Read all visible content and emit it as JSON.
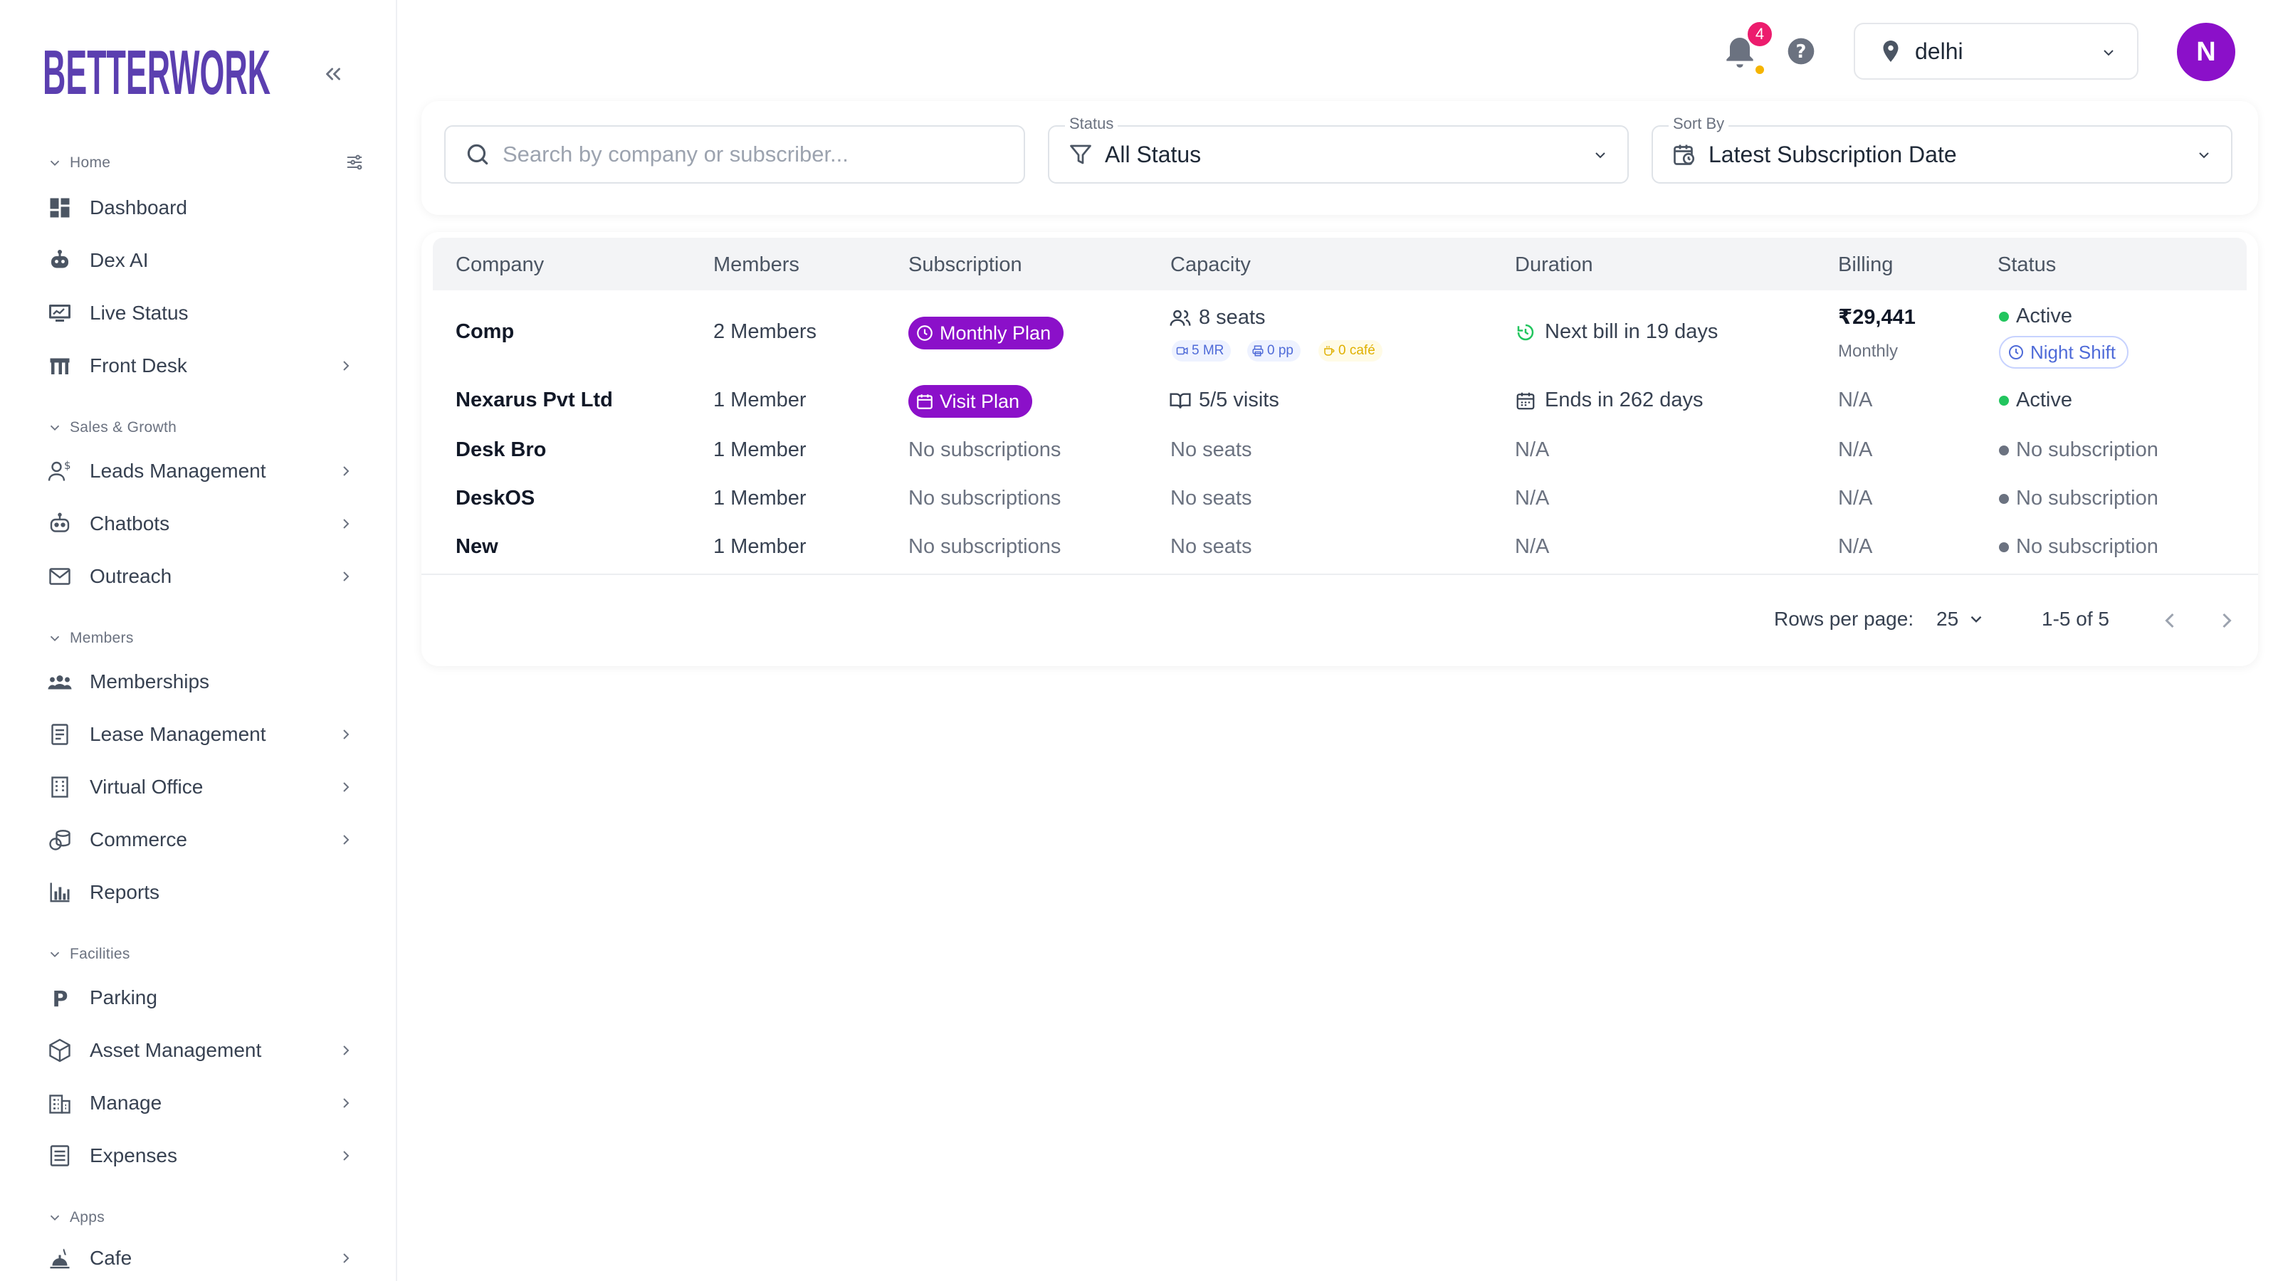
{
  "brand": {
    "logo_top": "BETTER",
    "logo_word": "WORK",
    "accent": "#5b3fb0",
    "purple": "#8b10c9"
  },
  "sidebar": {
    "sections": [
      {
        "label": "Home"
      },
      {
        "label": "Sales & Growth"
      },
      {
        "label": "Members"
      },
      {
        "label": "Facilities"
      },
      {
        "label": "Apps"
      }
    ],
    "items": [
      {
        "label": "Dashboard",
        "icon": "dashboard-icon"
      },
      {
        "label": "Dex AI",
        "icon": "robot-icon"
      },
      {
        "label": "Live Status",
        "icon": "monitor-icon"
      },
      {
        "label": "Front Desk",
        "icon": "storefront-icon"
      },
      {
        "label": "Leads Management",
        "icon": "user-dollar-icon"
      },
      {
        "label": "Chatbots",
        "icon": "chatbot-icon"
      },
      {
        "label": "Outreach",
        "icon": "mail-icon"
      },
      {
        "label": "Memberships",
        "icon": "group-icon"
      },
      {
        "label": "Lease Management",
        "icon": "document-icon"
      },
      {
        "label": "Virtual Office",
        "icon": "building-icon"
      },
      {
        "label": "Commerce",
        "icon": "coins-icon"
      },
      {
        "label": "Reports",
        "icon": "bar-chart-icon"
      },
      {
        "label": "Parking",
        "icon": "parking-icon"
      },
      {
        "label": "Asset Management",
        "icon": "cube-icon"
      },
      {
        "label": "Manage",
        "icon": "office-icon"
      },
      {
        "label": "Expenses",
        "icon": "receipt-icon"
      },
      {
        "label": "Cafe",
        "icon": "food-icon"
      }
    ]
  },
  "topbar": {
    "notification_count": "4",
    "location": "delhi",
    "avatar_initial": "N"
  },
  "filters": {
    "search_placeholder": "Search by company or subscriber...",
    "status_label": "Status",
    "status_value": "All Status",
    "sort_label": "Sort By",
    "sort_value": "Latest Subscription Date"
  },
  "table": {
    "columns": [
      "Company",
      "Members",
      "Subscription",
      "Capacity",
      "Duration",
      "Billing",
      "Status"
    ],
    "rows": [
      {
        "company": "Comp",
        "members": "2 Members",
        "subscription": "Monthly Plan",
        "capacity": "8 seats",
        "chips": [
          "5 MR",
          "0 pp",
          "0 café"
        ],
        "duration": "Next bill in 19 days",
        "billing": "₹29,441",
        "billing_sub": "Monthly",
        "status": "Active",
        "shift": "Night Shift"
      },
      {
        "company": "Nexarus Pvt Ltd",
        "members": "1 Member",
        "subscription": "Visit Plan",
        "capacity": "5/5 visits",
        "duration": "Ends in 262 days",
        "billing": "N/A",
        "status": "Active"
      },
      {
        "company": "Desk Bro",
        "members": "1 Member",
        "subscription": "No subscriptions",
        "capacity": "No seats",
        "duration": "N/A",
        "billing": "N/A",
        "status": "No subscription"
      },
      {
        "company": "DeskOS",
        "members": "1 Member",
        "subscription": "No subscriptions",
        "capacity": "No seats",
        "duration": "N/A",
        "billing": "N/A",
        "status": "No subscription"
      },
      {
        "company": "New",
        "members": "1 Member",
        "subscription": "No subscriptions",
        "capacity": "No seats",
        "duration": "N/A",
        "billing": "N/A",
        "status": "No subscription"
      }
    ]
  },
  "pagination": {
    "rows_label": "Rows per page:",
    "rows_value": "25",
    "range": "1-5 of 5"
  }
}
